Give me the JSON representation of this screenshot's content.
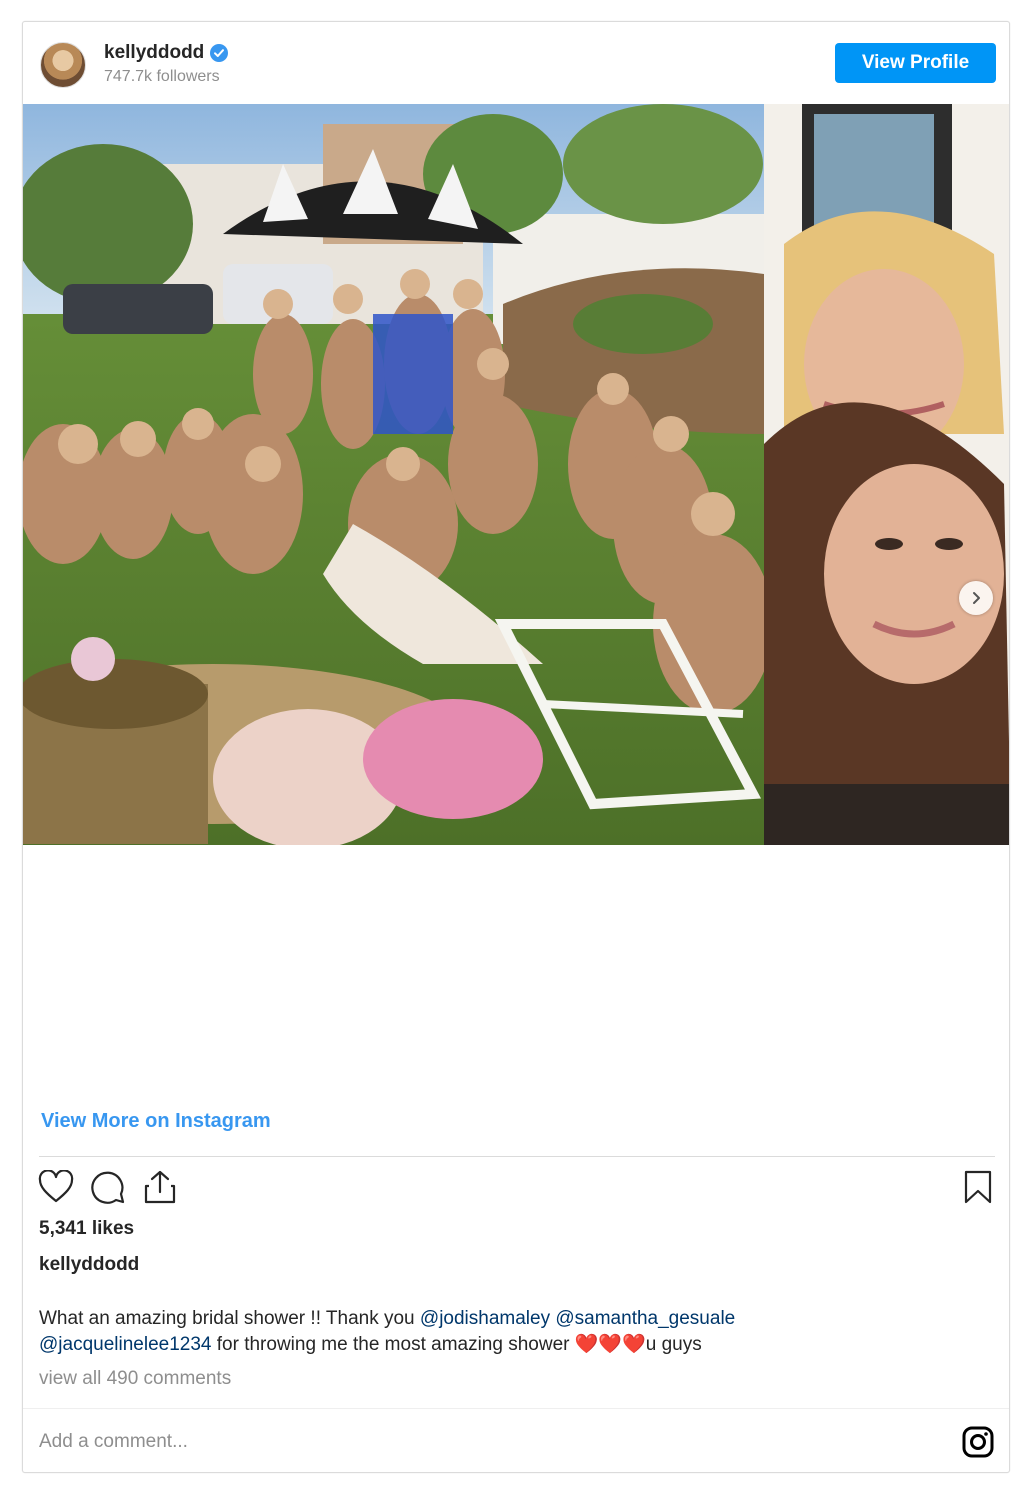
{
  "post": {
    "username": "kellyddodd",
    "followers": "747.7k followers",
    "view_profile_label": "View Profile",
    "view_more_label": "View More on Instagram",
    "likes": "5,341 likes",
    "caption_user": "kellyddodd",
    "caption": {
      "text_1": "What an amazing bridal shower !! Thank you ",
      "mention_1": "@jodishamaley",
      "mention_2": "@samantha_gesuale",
      "mention_3": "@jacquelinelee1234",
      "text_2": " for throwing me the most amazing shower ",
      "hearts": "❤️❤️❤️",
      "text_3": "u guys"
    },
    "view_comments": "view all 490 comments",
    "comment_placeholder": "Add a comment..."
  },
  "icons": {
    "verified": "verified-badge-icon",
    "like": "heart-icon",
    "comment": "comment-bubble-icon",
    "share": "share-icon",
    "save": "bookmark-icon",
    "next": "chevron-right-icon",
    "instagram": "instagram-logo-icon"
  },
  "colors": {
    "accent": "#0095f6",
    "link": "#3897f0",
    "mention": "#00376b",
    "muted": "#8e8e8e"
  }
}
